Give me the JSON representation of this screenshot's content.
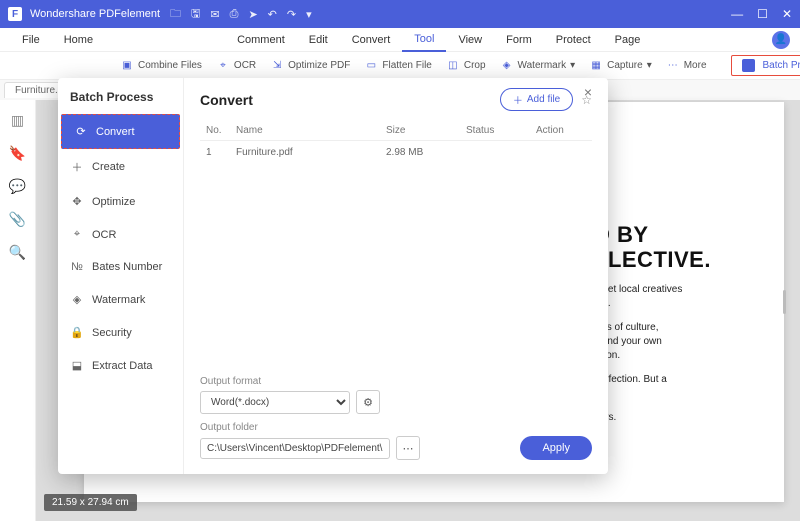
{
  "app": {
    "title": "Wondershare PDFelement"
  },
  "menubar": {
    "file": "File",
    "home": "Home",
    "comment": "Comment",
    "edit": "Edit",
    "convert": "Convert",
    "tool": "Tool",
    "view": "View",
    "form": "Form",
    "protect": "Protect",
    "page": "Page"
  },
  "toolbar": {
    "combine": "Combine Files",
    "ocr": "OCR",
    "optimize": "Optimize PDF",
    "flatten": "Flatten File",
    "crop": "Crop",
    "watermark": "Watermark",
    "capture": "Capture",
    "more": "More",
    "batch": "Batch Process"
  },
  "tab": {
    "name": "Furniture.pdf"
  },
  "batch": {
    "header": "Batch Process",
    "items": {
      "convert": "Convert",
      "create": "Create",
      "optimize": "Optimize",
      "ocr": "OCR",
      "bates": "Bates Number",
      "watermark": "Watermark",
      "security": "Security",
      "extract": "Extract Data"
    },
    "main_title": "Convert",
    "add_file": "Add file",
    "cols": {
      "no": "No.",
      "name": "Name",
      "size": "Size",
      "status": "Status",
      "action": "Action"
    },
    "rows": [
      {
        "no": "1",
        "name": "Furniture.pdf",
        "size": "2.98 MB",
        "status": "",
        "action": ""
      }
    ],
    "output_format_label": "Output format",
    "output_format_value": "Word(*.docx)",
    "output_folder_label": "Output folder",
    "output_folder_value": "C:\\Users\\Vincent\\Desktop\\PDFelement\\Con",
    "apply": "Apply"
  },
  "document": {
    "hl1": "D BY",
    "hl2": "LLECTIVE.",
    "p1": "meet local creatives",
    "p1b": "ers.",
    "p2a": "tails of culture,",
    "p2b": "o find your own",
    "p2c": "ssion.",
    "p3a": "perfection. But a",
    "p3b": ".",
    "p4": "ours.",
    "dimensions": "21.59 x 27.94 cm"
  }
}
